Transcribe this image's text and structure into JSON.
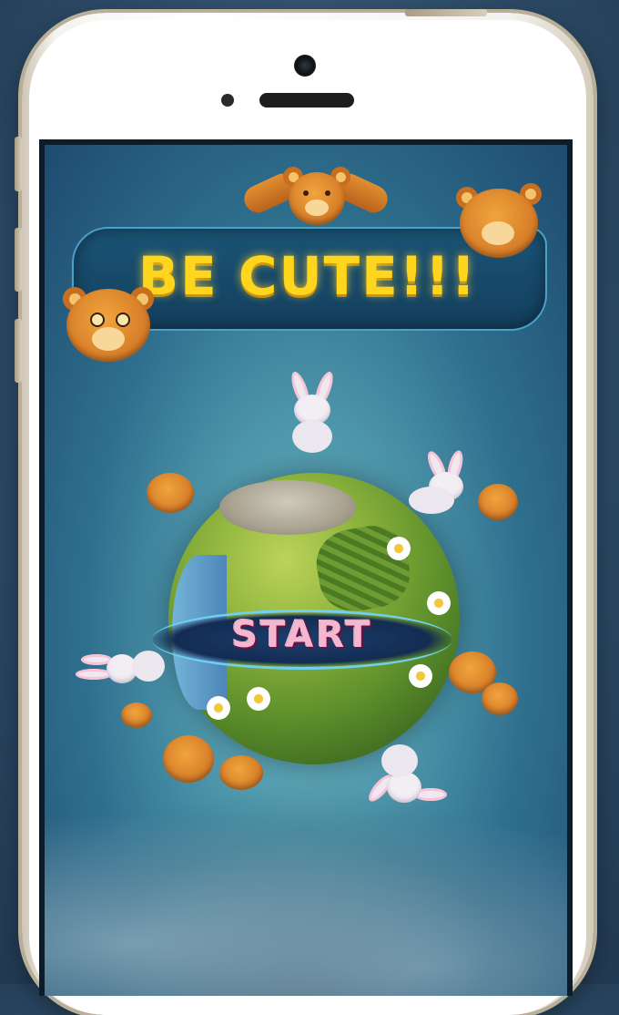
{
  "game": {
    "title": "BE CUTE!!!",
    "start_label": "START"
  },
  "colors": {
    "title": "#ffd61d",
    "start_text": "#f5b7cf",
    "banner": "#1b5476",
    "sky": "#4f98ac"
  },
  "decor": {
    "characters": [
      "bear-icon",
      "bunny-icon",
      "planet-globe"
    ]
  }
}
